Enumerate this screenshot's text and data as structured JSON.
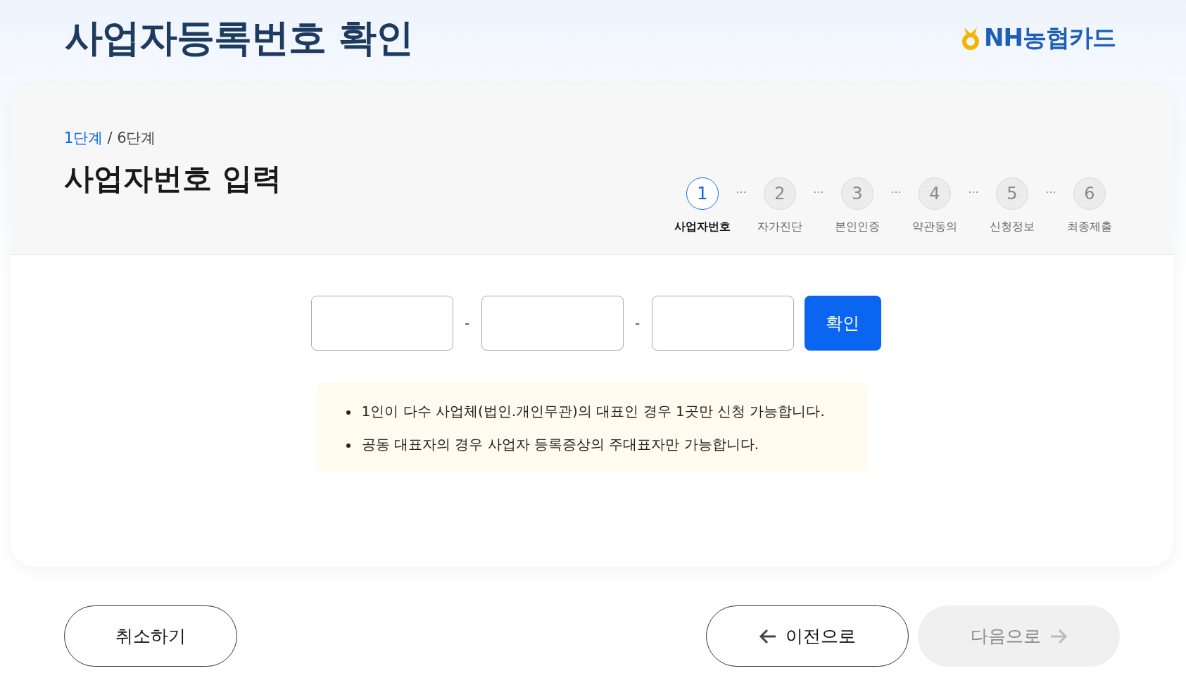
{
  "header": {
    "title": "사업자등록번호 확인",
    "logo": "NH농협카드"
  },
  "card": {
    "step_current": "1단계",
    "step_total": "/ 6단계",
    "heading": "사업자번호 입력",
    "steps": [
      {
        "number": "1",
        "label": "사업자번호",
        "selected": true
      },
      {
        "number": "2",
        "label": "자가진단",
        "selected": false
      },
      {
        "number": "3",
        "label": "본인인증",
        "selected": false
      },
      {
        "number": "4",
        "label": "약관동의",
        "selected": false
      },
      {
        "number": "5",
        "label": "신청정보",
        "selected": false
      },
      {
        "number": "6",
        "label": "최종제출",
        "selected": false
      }
    ],
    "step_separator": "···",
    "inputs": [
      {
        "kind": "text"
      },
      {
        "kind": "text"
      },
      {
        "kind": "text"
      }
    ],
    "input_separator": "-",
    "confirm_button": "확인",
    "notices": [
      "1인이 다수 사업체(법인.개인무관)의 대표인 경우 1곳만 신청 가능합니다.",
      "공동 대표자의 경우 사업자 등록증상의 주대표자만 가능합니다."
    ]
  },
  "footer": {
    "cancel": "취소하기",
    "prev": "이전으로",
    "next": {
      "label": "다음으로",
      "disabled": true
    }
  }
}
